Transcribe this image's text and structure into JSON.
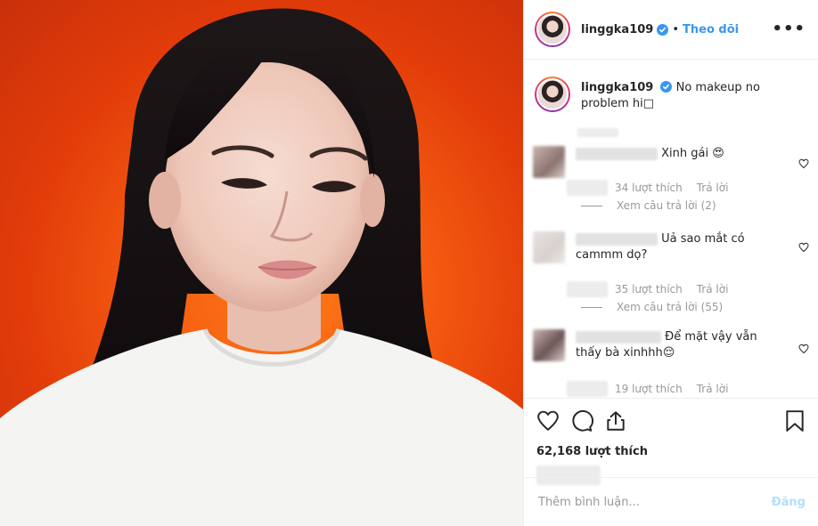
{
  "post": {
    "username": "linggka109",
    "separator": "•",
    "follow_label": "Theo dõi",
    "more_label": "•••",
    "caption": "No makeup no problem hi□"
  },
  "comments": [
    {
      "text": "Xinh gái 😍",
      "likes": "34 lượt thích",
      "reply": "Trả lời",
      "view_replies": "Xem câu trả lời (2)"
    },
    {
      "text": "Uả sao mắt có cammm dọ?",
      "likes": "35 lượt thích",
      "reply": "Trả lời",
      "view_replies": "Xem câu trả lời (55)"
    },
    {
      "text": "Để mặt vậy vẫn thấy bà xinhhh😌",
      "likes": "19 lượt thích",
      "reply": "Trả lời"
    }
  ],
  "actions": {
    "likes_count": "62,168 lượt thích",
    "icons": [
      "heart-icon",
      "comment-icon",
      "share-icon",
      "bookmark-icon"
    ]
  },
  "add_comment": {
    "placeholder": "Thêm bình luận...",
    "post_label": "Đăng"
  },
  "colors": {
    "accent": "#3897f0",
    "disabled_post": "#b2dffc",
    "background_orange": "#f45a10"
  }
}
